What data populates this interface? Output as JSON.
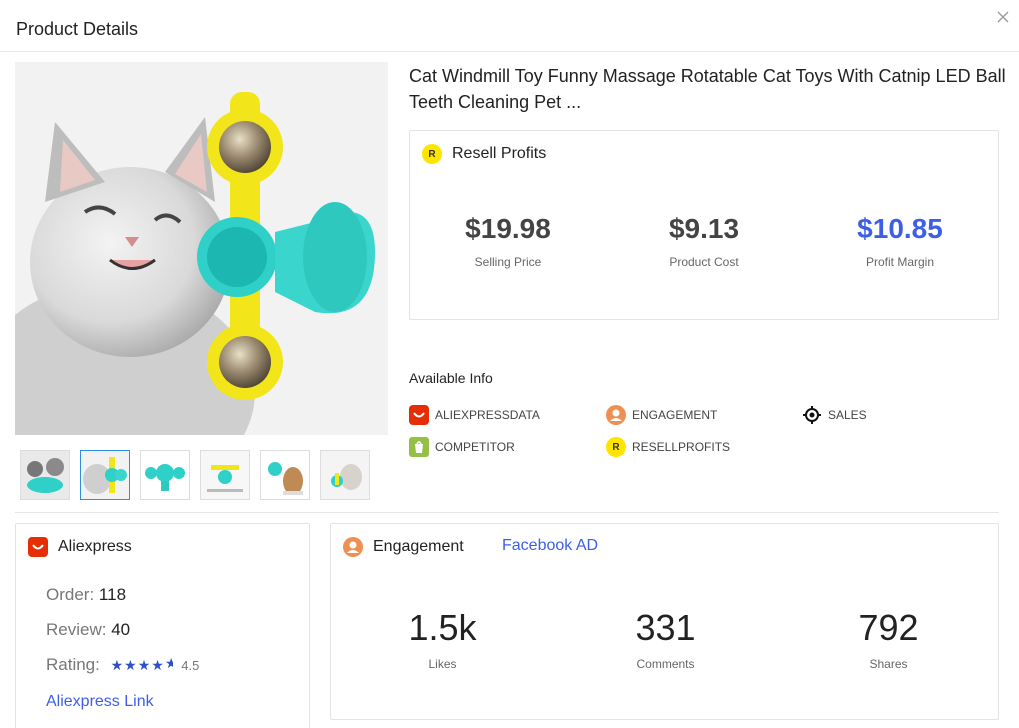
{
  "header": {
    "title": "Product Details"
  },
  "product": {
    "title": "Cat Windmill Toy Funny Massage Rotatable Cat Toys With Catnip LED Ball Teeth Cleaning Pet ..."
  },
  "resell": {
    "heading": "Resell Profits",
    "badge": "R",
    "selling_price": {
      "value": "$19.98",
      "label": "Selling Price"
    },
    "product_cost": {
      "value": "$9.13",
      "label": "Product Cost"
    },
    "profit_margin": {
      "value": "$10.85",
      "label": "Profit Margin"
    }
  },
  "available_info": {
    "title": "Available Info",
    "items": [
      {
        "label": "ALIEXPRESSDATA",
        "icon": "aliexpress-icon"
      },
      {
        "label": "ENGAGEMENT",
        "icon": "person-icon"
      },
      {
        "label": "SALES",
        "icon": "target-icon"
      },
      {
        "label": "COMPETITOR",
        "icon": "shopify-icon"
      },
      {
        "label": "RESELLPROFITS",
        "icon": "resell-r-icon",
        "badge": "R"
      }
    ]
  },
  "aliexpress": {
    "heading": "Aliexpress",
    "order_label": "Order:",
    "order_value": "118",
    "review_label": "Review:",
    "review_value": "40",
    "rating_label": "Rating:",
    "rating_value": "4.5",
    "rating_stars": "★★★★",
    "link_label": "Aliexpress Link"
  },
  "engagement": {
    "heading": "Engagement",
    "tab_link": "Facebook AD",
    "likes": {
      "value": "1.5k",
      "label": "Likes"
    },
    "comments": {
      "value": "331",
      "label": "Comments"
    },
    "shares": {
      "value": "792",
      "label": "Shares"
    }
  },
  "thumbnails": {
    "active_index": 1,
    "count": 6
  },
  "colors": {
    "accent_blue": "#3d5fe6",
    "resell_yellow": "#ffe400",
    "aliexpress_red": "#e62e04",
    "engagement_orange": "#f08f52",
    "shopify_green": "#95bf47",
    "thumb_active": "#2c8fe0"
  }
}
